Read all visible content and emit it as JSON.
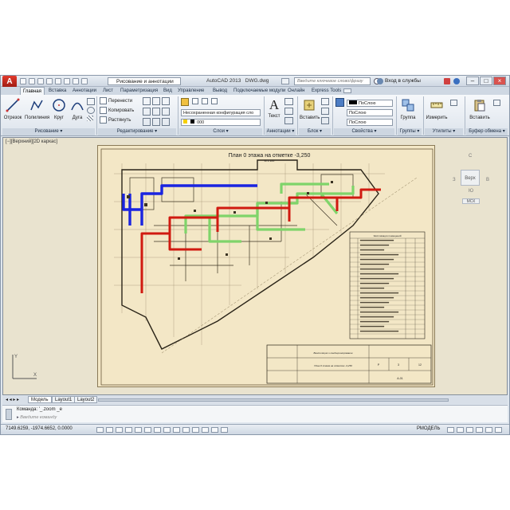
{
  "app": {
    "title": "AutoCAD 2013",
    "file": "DWG.dwg",
    "logo_letter": "A",
    "workspace": "Рисование и аннотации",
    "search_placeholder": "Введите ключевое слово/фразу",
    "signin": "Вход в службы",
    "colors": {
      "logo": "#c8281c",
      "heating": "#d01a10",
      "supply": "#1a24e0",
      "exhaust": "#7fd46a"
    }
  },
  "tabs": [
    "Главная",
    "Вставка",
    "Аннотации",
    "Лист",
    "Параметризация",
    "Вид",
    "Управление",
    "Вывод",
    "Подключаемые модули",
    "Онлайн",
    "Express Tools"
  ],
  "ribbon": {
    "draw": {
      "label": "Рисование",
      "line": "Отрезок",
      "polyline": "Полилиния",
      "circle": "Круг",
      "arc": "Дуга"
    },
    "modify": {
      "label": "Редактирование",
      "move": "Перенести",
      "copy": "Копировать",
      "stretch": "Растянуть"
    },
    "layers": {
      "label": "Слои",
      "layer_state": "Несохраненная конфигурация сло",
      "current_layer": "000"
    },
    "annotation": {
      "label": "Аннотации",
      "text": "Текст"
    },
    "block": {
      "label": "Блок",
      "insert": "Вставить"
    },
    "properties": {
      "label": "Свойства",
      "by_layer_1": "ПоСлою",
      "by_layer_2": "ПоСлою",
      "by_layer_3": "ПоСлою"
    },
    "groups": {
      "label": "Группы",
      "group": "Группа"
    },
    "utilities": {
      "label": "Утилиты",
      "measure": "Измерить"
    },
    "clipboard": {
      "label": "Буфер обмена",
      "paste": "Вставить"
    }
  },
  "viewport": {
    "label": "[−][Верхний][2D каркас]",
    "viewcube_face": "Верх",
    "viewcube_n": "С",
    "viewcube_s": "Ю",
    "viewcube_w": "З",
    "viewcube_e": "В",
    "wcs": "МСК"
  },
  "drawing": {
    "title": "План 0 этажа на отметке -3,250",
    "scale": "М 1:100",
    "legend_title": "Экспликация помещений",
    "stamp_text_1": "Вентиляция и кондиционирование",
    "stamp_text_2": "План 0 этажа на отметке -3,250",
    "stamp_cells": [
      "Р",
      "3",
      "12"
    ],
    "stamp_sheet": "А-01"
  },
  "layout_tabs": [
    "Модель",
    "Layout1",
    "Layout2"
  ],
  "command": {
    "history": "Команда: '_.zoom _e",
    "input_placeholder": "Введите команду"
  },
  "status": {
    "coordinates": "7149.6259, -1974.6652, 0.0000",
    "model": "РМОДЕЛЬ"
  }
}
